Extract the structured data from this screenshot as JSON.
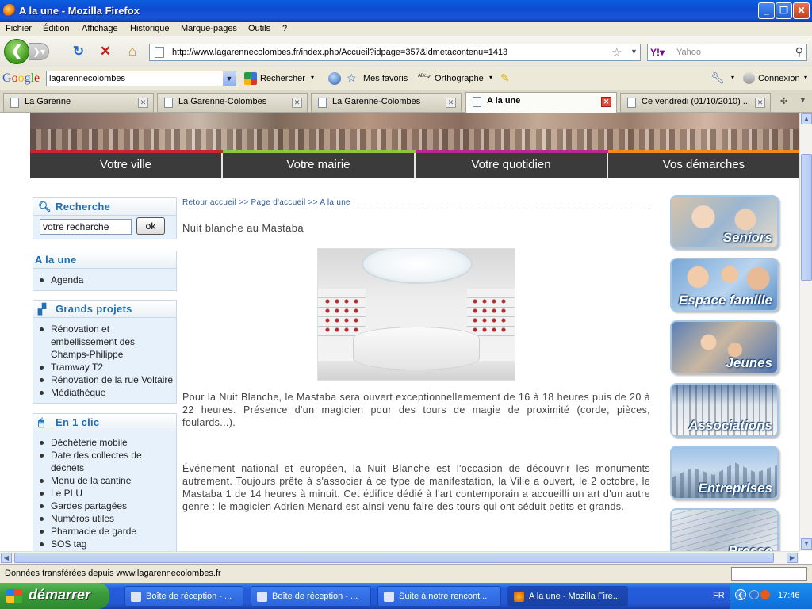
{
  "window": {
    "title": "A la une - Mozilla Firefox"
  },
  "menu": [
    "Fichier",
    "Édition",
    "Affichage",
    "Historique",
    "Marque-pages",
    "Outils",
    "?"
  ],
  "nav": {
    "url": "http://www.lagarennecolombes.fr/index.php/Accueil?idpage=357&idmetacontenu=1413",
    "search_placeholder": "Yahoo"
  },
  "google_toolbar": {
    "logo": "Google",
    "query": "lagarennecolombes",
    "search_label": "Rechercher",
    "favorites_label": "Mes favoris",
    "spell_label": "Orthographe",
    "login_label": "Connexion"
  },
  "tabs": [
    {
      "label": "La Garenne"
    },
    {
      "label": "La Garenne-Colombes"
    },
    {
      "label": "La Garenne-Colombes"
    },
    {
      "label": "A la une"
    },
    {
      "label": "Ce vendredi (01/10/2010) ..."
    }
  ],
  "site": {
    "menu": [
      "Votre ville",
      "Votre mairie",
      "Votre quotidien",
      "Vos démarches"
    ],
    "menu_colors": [
      "#c8262c",
      "#8cc63e",
      "#b8288f",
      "#f08a1c"
    ],
    "breadcrumb": "Retour accueil >> Page d'accueil >> A la une",
    "article": {
      "title": "Nuit blanche au Mastaba",
      "p1": "Pour la Nuit Blanche, le Mastaba sera ouvert exceptionnellemement  de 16 à 18 heures puis de 20 à 22 heures. Présence d'un magicien pour des tours de magie de proximité (corde, pièces, foulards...).",
      "p2": "Événement national et européen, la Nuit Blanche est l'occasion de découvrir les monuments autrement. Toujours prête à s'associer à ce type de manifestation, la Ville a ouvert, le 2 octobre, le Mastaba 1 de 14 heures à minuit. Cet édifice dédié à l'art contemporain a accueilli un art d'un autre genre : le magicien Adrien Menard est ainsi venu faire des tours qui ont séduit petits et grands."
    },
    "search": {
      "title": "Recherche",
      "value": "votre recherche",
      "button": "ok"
    },
    "alaune": {
      "title": "A la une",
      "items": [
        "Agenda"
      ]
    },
    "projets": {
      "title": "Grands projets",
      "items": [
        "Rénovation et embellissement des Champs-Philippe",
        "Tramway T2",
        "Rénovation de la rue Voltaire",
        "Médiathèque"
      ]
    },
    "clic": {
      "title": "En 1 clic",
      "items": [
        "Déchèterie mobile",
        "Date des collectes de déchets",
        "Menu de la cantine",
        "Le PLU",
        "Gardes partagées",
        "Numéros utiles",
        "Pharmacie de garde",
        "SOS tag"
      ]
    },
    "tiles": [
      "Seniors",
      "Espace famille",
      "Jeunes",
      "Associations",
      "Entreprises",
      "Presse"
    ]
  },
  "status": {
    "text": "Données transférées depuis www.lagarennecolombes.fr"
  },
  "taskbar": {
    "start": "démarrer",
    "tasks": [
      "Boîte de réception - ...",
      "Boîte de réception - ...",
      "Suite à notre rencont...",
      "A la une - Mozilla Fire..."
    ],
    "lang": "FR",
    "clock": "17:46"
  }
}
